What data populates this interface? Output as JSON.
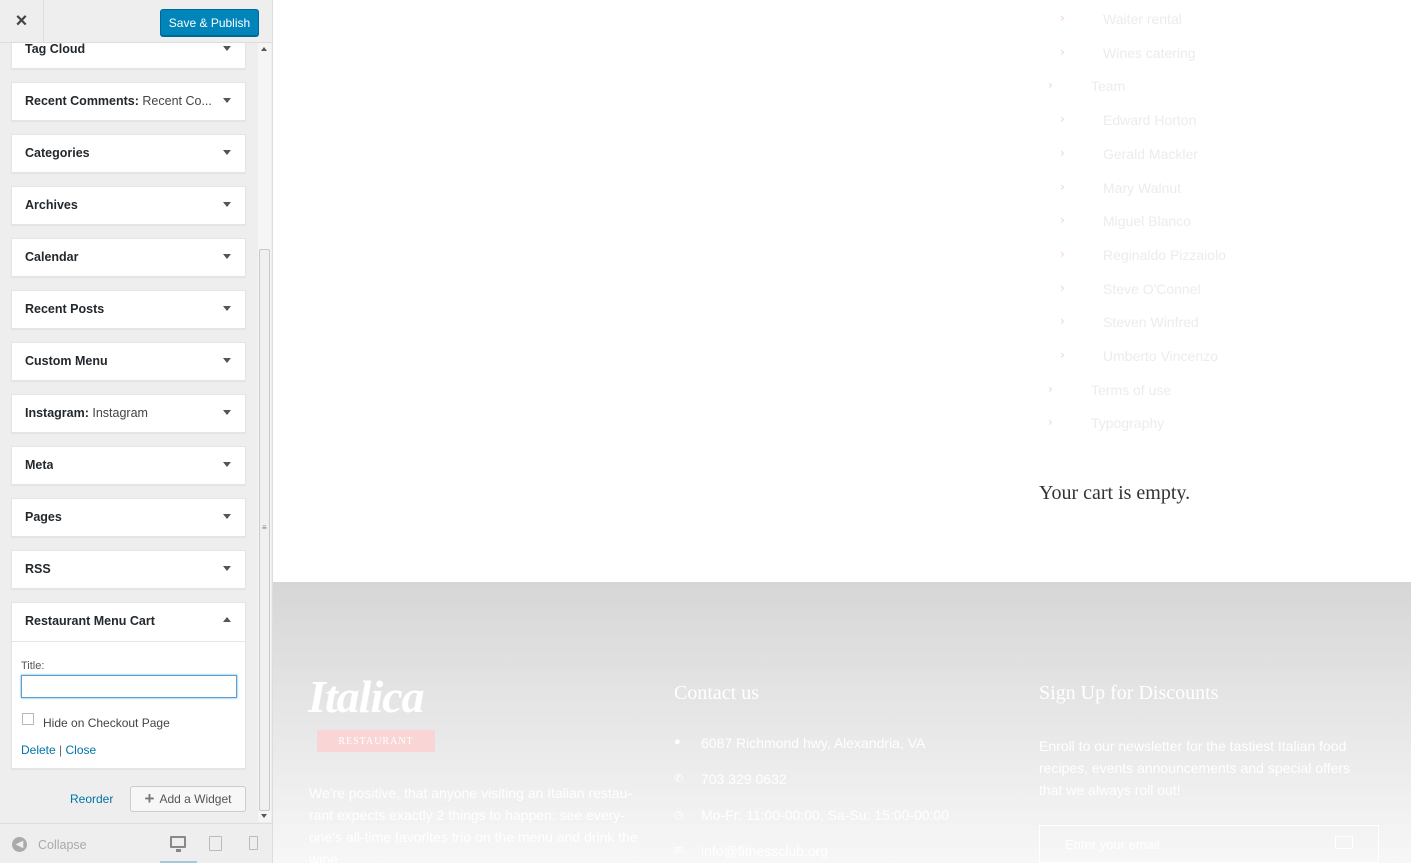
{
  "header": {
    "close_icon": "×",
    "save_label": "Save & Publish"
  },
  "widgets": [
    {
      "title": "Tag Cloud",
      "subtitle": ""
    },
    {
      "title": "Recent Comments:",
      "subtitle": " Recent Co..."
    },
    {
      "title": "Categories",
      "subtitle": ""
    },
    {
      "title": "Archives",
      "subtitle": ""
    },
    {
      "title": "Calendar",
      "subtitle": ""
    },
    {
      "title": "Recent Posts",
      "subtitle": ""
    },
    {
      "title": "Custom Menu",
      "subtitle": ""
    },
    {
      "title": "Instagram:",
      "subtitle": " Instagram"
    },
    {
      "title": "Meta",
      "subtitle": ""
    },
    {
      "title": "Pages",
      "subtitle": ""
    },
    {
      "title": "RSS",
      "subtitle": ""
    }
  ],
  "open_widget": {
    "title": "Restaurant Menu Cart",
    "field_label": "Title:",
    "field_value": "",
    "checkbox_label": "Hide on Checkout Page",
    "checkbox_checked": false,
    "delete_label": "Delete",
    "separator": " | ",
    "close_label": "Close"
  },
  "actions": {
    "reorder_label": "Reorder",
    "add_widget_label": "Add a Widget"
  },
  "footer": {
    "collapse_label": "Collapse"
  },
  "preview": {
    "pages": [
      {
        "label": "Waiter rental",
        "level": 2
      },
      {
        "label": "Wines catering",
        "level": 2
      },
      {
        "label": "Team",
        "level": 1
      },
      {
        "label": "Edward Horton",
        "level": 2
      },
      {
        "label": "Gerald Mackler",
        "level": 2
      },
      {
        "label": "Mary Walnut",
        "level": 2
      },
      {
        "label": "Miguel Blanco",
        "level": 2
      },
      {
        "label": "Reginaldo Pizzaiolo",
        "level": 2
      },
      {
        "label": "Steve O'Connel",
        "level": 2
      },
      {
        "label": "Steven Winfred",
        "level": 2
      },
      {
        "label": "Umberto Vincenzo",
        "level": 2
      },
      {
        "label": "Terms of use",
        "level": 1
      },
      {
        "label": "Typography",
        "level": 1
      }
    ],
    "cart_text": "Your cart is empty.",
    "logo_text": "Italica",
    "logo_sub": "RESTAURANT",
    "about_text": "We're positive, that anyone visiting an Italian restau-rant expects exactly 2 things to happen: see every-one's all-time favorites trio on the menu and drink the wine",
    "contact_heading": "Contact us",
    "contact": {
      "address": "6087 Richmond hwy, Alexandria, VA",
      "phone": "703 329 0632",
      "hours": "Mo-Fr: 11:00-00:00, Sa-Su: 15:00-00:00",
      "email": "info@fitnessclub.org"
    },
    "signup_heading": "Sign Up for Discounts",
    "signup_text": "Enroll to our newsletter for the tastiest Italian food recipes, events announcements and special offers that we always roll out!",
    "email_placeholder": "Enter your email"
  },
  "colors": {
    "accent": "#0085ba",
    "link": "#0073aa",
    "chevron": "#f6cdd5"
  }
}
